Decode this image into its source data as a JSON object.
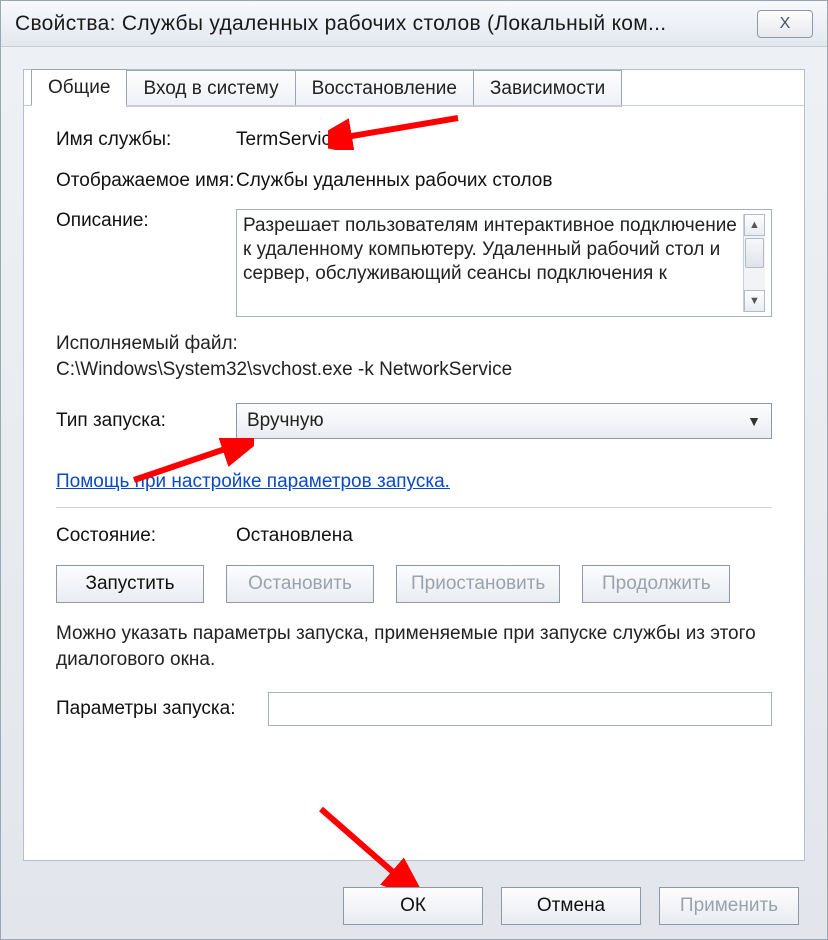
{
  "window": {
    "title": "Свойства: Службы удаленных рабочих столов (Локальный ком...",
    "close_char": "X"
  },
  "tabs": [
    {
      "label": "Общие",
      "active": true
    },
    {
      "label": "Вход в систему",
      "active": false
    },
    {
      "label": "Восстановление",
      "active": false
    },
    {
      "label": "Зависимости",
      "active": false
    }
  ],
  "general": {
    "service_name_label": "Имя службы:",
    "service_name": "TermService",
    "display_name_label": "Отображаемое имя:",
    "display_name": "Службы удаленных рабочих столов",
    "description_label": "Описание:",
    "description": "Разрешает пользователям интерактивное подключение к удаленному компьютеру. Удаленный рабочий стол и сервер, обслуживающий сеансы подключения к",
    "exec_label": "Исполняемый файл:",
    "exec_path": "C:\\Windows\\System32\\svchost.exe -k NetworkService",
    "startup_label": "Тип запуска:",
    "startup_value": "Вручную",
    "help_link": "Помощь при настройке параметров запуска.",
    "state_label": "Состояние:",
    "state_value": "Остановлена",
    "start_btn": "Запустить",
    "stop_btn": "Остановить",
    "pause_btn": "Приостановить",
    "resume_btn": "Продолжить",
    "hint": "Можно указать параметры запуска, применяемые при запуске службы из этого диалогового окна.",
    "params_label": "Параметры запуска:",
    "params_value": ""
  },
  "footer": {
    "ok": "ОК",
    "cancel": "Отмена",
    "apply": "Применить"
  }
}
